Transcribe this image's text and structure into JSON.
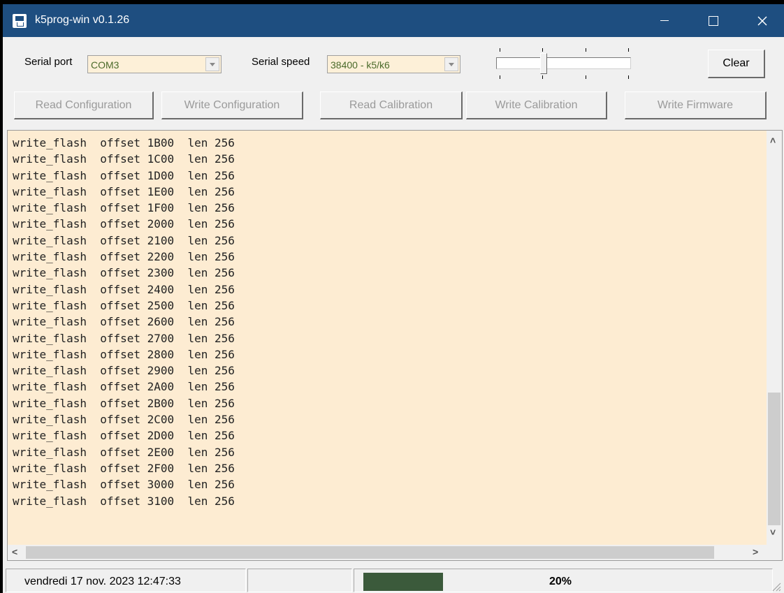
{
  "window": {
    "title": "k5prog-win v0.1.26"
  },
  "serial": {
    "port_label": "Serial port",
    "port_value": "COM3",
    "speed_label": "Serial speed",
    "speed_value": "38400 - k5/k6"
  },
  "toolbar": {
    "clear_label": "Clear",
    "read_config_label": "Read Configuration",
    "write_config_label": "Write Configuration",
    "read_calib_label": "Read Calibration",
    "write_calib_label": "Write Calibration",
    "write_firmware_label": "Write Firmware"
  },
  "log": {
    "lines": [
      "write_flash  offset 1B00  len 256",
      "write_flash  offset 1C00  len 256",
      "write_flash  offset 1D00  len 256",
      "write_flash  offset 1E00  len 256",
      "write_flash  offset 1F00  len 256",
      "write_flash  offset 2000  len 256",
      "write_flash  offset 2100  len 256",
      "write_flash  offset 2200  len 256",
      "write_flash  offset 2300  len 256",
      "write_flash  offset 2400  len 256",
      "write_flash  offset 2500  len 256",
      "write_flash  offset 2600  len 256",
      "write_flash  offset 2700  len 256",
      "write_flash  offset 2800  len 256",
      "write_flash  offset 2900  len 256",
      "write_flash  offset 2A00  len 256",
      "write_flash  offset 2B00  len 256",
      "write_flash  offset 2C00  len 256",
      "write_flash  offset 2D00  len 256",
      "write_flash  offset 2E00  len 256",
      "write_flash  offset 2F00  len 256",
      "write_flash  offset 3000  len 256",
      "write_flash  offset 3100  len 256"
    ]
  },
  "status": {
    "datetime": "vendredi 17 nov. 2023  12:47:33",
    "progress_percent": 20,
    "progress_label": "20%"
  },
  "colors": {
    "titlebar": "#1e4e80",
    "log_background": "#fdecd2",
    "combo_background": "#fdf0d8",
    "progress_fill": "#3b5a3b"
  },
  "icons": {
    "app": "app-icon",
    "minimize": "minimize-icon",
    "maximize": "maximize-icon",
    "close": "close-icon"
  }
}
